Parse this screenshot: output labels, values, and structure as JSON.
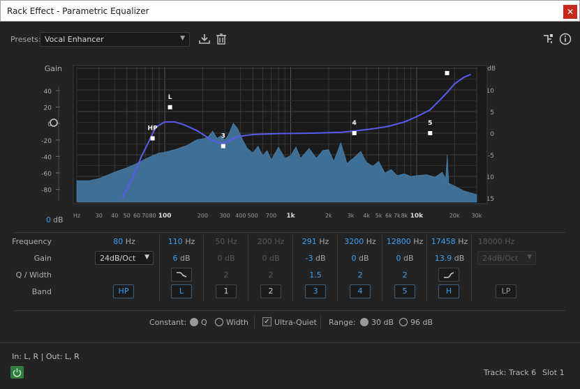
{
  "window": {
    "title": "Rack Effect - Parametric Equalizer",
    "close_glyph": "✕"
  },
  "presets": {
    "label": "Presets:",
    "value": "Vocal Enhancer"
  },
  "graph": {
    "gain_title": "Gain",
    "db_title": "dB",
    "gain_ticks": [
      "40",
      "20",
      "0",
      "-20",
      "-40",
      "-60",
      "-80"
    ],
    "db_ticks": [
      "10",
      "5",
      "0",
      "-5",
      "-10",
      "-15"
    ],
    "freq_ticks": [
      "Hz",
      "30",
      "40",
      "50",
      "60",
      "70",
      "80",
      "100",
      "200",
      "300",
      "400",
      "500",
      "700",
      "1k",
      "2k",
      "3k",
      "4k",
      "5k",
      "6k",
      "7k",
      "8k",
      "10k",
      "20k",
      "30k"
    ],
    "freq_bold": [
      "100",
      "1k",
      "10k"
    ],
    "gain_readout_value": "0",
    "gain_readout_unit": "dB",
    "handles": [
      {
        "label": "HP",
        "freq": 80,
        "gain_db": -1.2
      },
      {
        "label": "L",
        "freq": 110,
        "gain_db": 6
      },
      {
        "label": "3",
        "freq": 291,
        "gain_db": -3
      },
      {
        "label": "4",
        "freq": 3200,
        "gain_db": 0
      },
      {
        "label": "5",
        "freq": 12800,
        "gain_db": 0
      },
      {
        "label": "",
        "freq": 17458,
        "gain_db": 13.9
      }
    ]
  },
  "labels": {
    "frequency": "Frequency",
    "gain": "Gain",
    "q_width": "Q / Width",
    "band": "Band"
  },
  "columns": [
    {
      "freq": "80",
      "freq_unit": "Hz",
      "gain_select": "24dB/Oct",
      "band": "HP",
      "active": true
    },
    {
      "freq": "110",
      "freq_unit": "Hz",
      "gain": "6",
      "gain_unit": "dB",
      "band": "L",
      "active": true
    },
    {
      "freq": "50",
      "freq_unit": "Hz",
      "gain": "0",
      "gain_unit": "dB",
      "q": "2",
      "band": "1",
      "active": false
    },
    {
      "freq": "200",
      "freq_unit": "Hz",
      "gain": "0",
      "gain_unit": "dB",
      "q": "2",
      "band": "2",
      "active": false
    },
    {
      "freq": "291",
      "freq_unit": "Hz",
      "gain": "-3",
      "gain_unit": "dB",
      "q": "1.5",
      "band": "3",
      "active": true
    },
    {
      "freq": "3200",
      "freq_unit": "Hz",
      "gain": "0",
      "gain_unit": "dB",
      "q": "2",
      "band": "4",
      "active": true
    },
    {
      "freq": "12800",
      "freq_unit": "Hz",
      "gain": "0",
      "gain_unit": "dB",
      "q": "2",
      "band": "5",
      "active": true
    },
    {
      "freq": "17458",
      "freq_unit": "Hz",
      "gain": "13.9",
      "gain_unit": "dB",
      "band": "H",
      "active": true
    },
    {
      "freq": "18000",
      "freq_unit": "Hz",
      "gain_select": "24dB/Oct",
      "band": "LP",
      "active": false
    }
  ],
  "bottom": {
    "constant_label": "Constant:",
    "q_label": "Q",
    "width_label": "Width",
    "ultra_quiet_label": "Ultra-Quiet",
    "range_label": "Range:",
    "range_30": "30 dB",
    "range_96": "96 dB"
  },
  "footer": {
    "io": "In: L, R | Out: L, R",
    "track": "Track: Track 6",
    "slot": "Slot 1"
  },
  "colors": {
    "accent": "#3ea0f5",
    "spectrum": "#3f6f95",
    "curve": "#5a5cf0",
    "close": "#c42b1c",
    "power": "#2e7d3e"
  }
}
